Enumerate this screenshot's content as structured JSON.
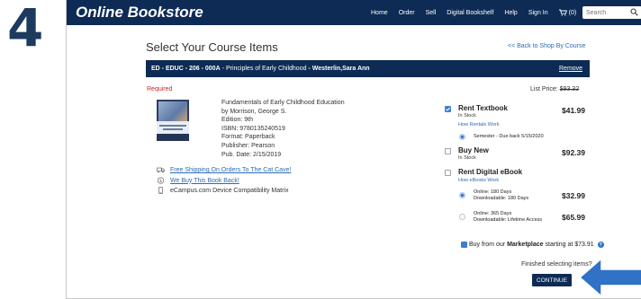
{
  "step_number": "4",
  "header": {
    "brand": "Online Bookstore",
    "nav": [
      "Home",
      "Order",
      "Sell",
      "Digital Bookshelf",
      "Help",
      "Sign In"
    ],
    "cart_count": "(0)",
    "search_placeholder": "Search"
  },
  "page": {
    "title": "Select Your Course Items",
    "back_link": "<< Back to Shop By Course"
  },
  "course": {
    "code": "ED - EDUC - 206 - 000A",
    "separator": " - ",
    "name": "Principles of Early Childhood",
    "instructor": "- Westerlin,Sara Ann",
    "remove_label": "Remove"
  },
  "required_label": "Required",
  "list_price": {
    "label": "List Price:",
    "value": "$93.32"
  },
  "book": {
    "title": "Fundamentals of Early Childhood Education",
    "author": "by Morrison, George S.",
    "edition": "Edition: 9th",
    "isbn": "ISBN: 9780135240519",
    "format": "Format: Paperback",
    "publisher": "Publisher: Pearson",
    "pub_date": "Pub. Date: 2/15/2019",
    "cover_caption": "Fundamentals of Early Childhood Education"
  },
  "promos": [
    {
      "text": "Free Shipping On Orders To The Cat Cave!",
      "icon": "truck-icon"
    },
    {
      "text": "We Buy This Book Back!",
      "icon": "dollar-icon"
    },
    {
      "text": "eCampus.com Device Compatibility Matrix",
      "icon": "device-icon"
    }
  ],
  "options": {
    "rent": {
      "title": "Rent Textbook",
      "stock": "In Stock",
      "link": "How Rentals Work",
      "price": "$41.99",
      "checked": true,
      "semester": "Semester - Due back 5/15/2020"
    },
    "buy_new": {
      "title": "Buy New",
      "stock": "In Stock",
      "price": "$92.39",
      "checked": false
    },
    "ebook": {
      "title": "Rent Digital eBook",
      "link": "How eBooks Work",
      "checked": false,
      "plans": [
        {
          "line1": "Online: 180 Days",
          "line2": "Downloadable: 180 Days",
          "price": "$32.99",
          "selected": true
        },
        {
          "line1": "Online: 365 Days",
          "line2": "Downloadable: Lifetime Access",
          "price": "$65.99",
          "selected": false
        }
      ]
    }
  },
  "marketplace": {
    "prefix": "Buy from our",
    "emph": "Marketplace",
    "suffix": "starting at $73.91"
  },
  "finished_text": "Finished selecting items?",
  "continue_label": "CONTINUE",
  "colors": {
    "navy": "#0d2b54",
    "link": "#2a6bb5",
    "required": "#c0282b",
    "arrow": "#2f72c6",
    "step": "#1d3a5f"
  }
}
